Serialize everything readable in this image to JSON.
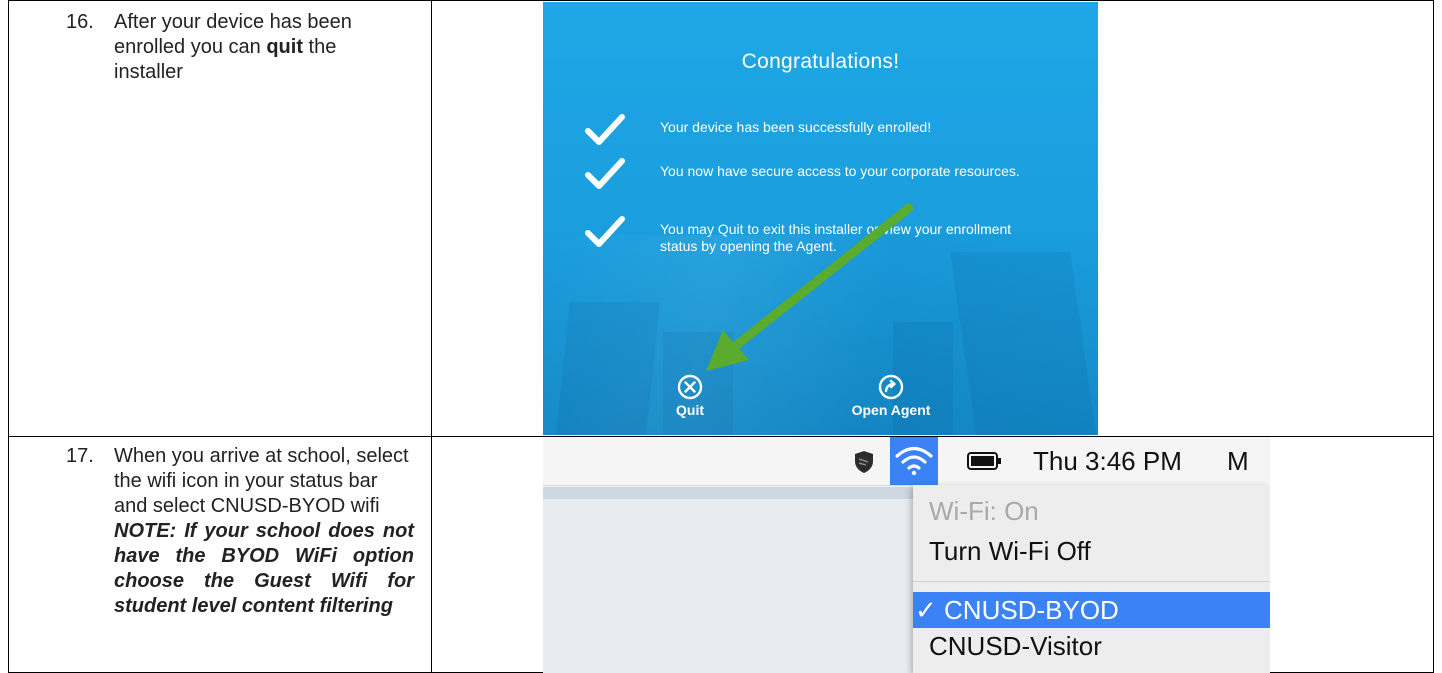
{
  "steps": [
    {
      "number": "16.",
      "text_before": "After your device has been enrolled you can ",
      "bold_word": "quit",
      "text_after": " the installer"
    },
    {
      "number": "17.",
      "text": "When you arrive at school, select the wifi icon in your status bar and select CNUSD-BYOD wifi",
      "note": "NOTE: If your school does not have the BYOD WiFi option choose the Guest Wifi for student level content filtering"
    }
  ],
  "enrollment_screen": {
    "title": "Congratulations!",
    "items": [
      "Your device has been successfully enrolled!",
      "You now have secure access to your corporate resources.",
      "You may Quit to exit this installer or view your enrollment status by opening the Agent."
    ],
    "quit_label": "Quit",
    "open_agent_label": "Open Agent",
    "arrow_color": "#5aab2e",
    "background_color": "#1ea7e6"
  },
  "menubar": {
    "clock": "Thu 3:46 PM",
    "truncated_next_item": "M",
    "icons": [
      "shield-icon",
      "wifi-icon",
      "battery-icon"
    ]
  },
  "wifi_menu": {
    "status": "Wi-Fi: On",
    "toggle": "Turn Wi-Fi Off",
    "networks": [
      {
        "name": "CNUSD-BYOD",
        "selected": true
      },
      {
        "name": "CNUSD-Visitor",
        "selected": false
      }
    ],
    "selected_marker": "✓",
    "highlight_color": "#3b82f6"
  }
}
